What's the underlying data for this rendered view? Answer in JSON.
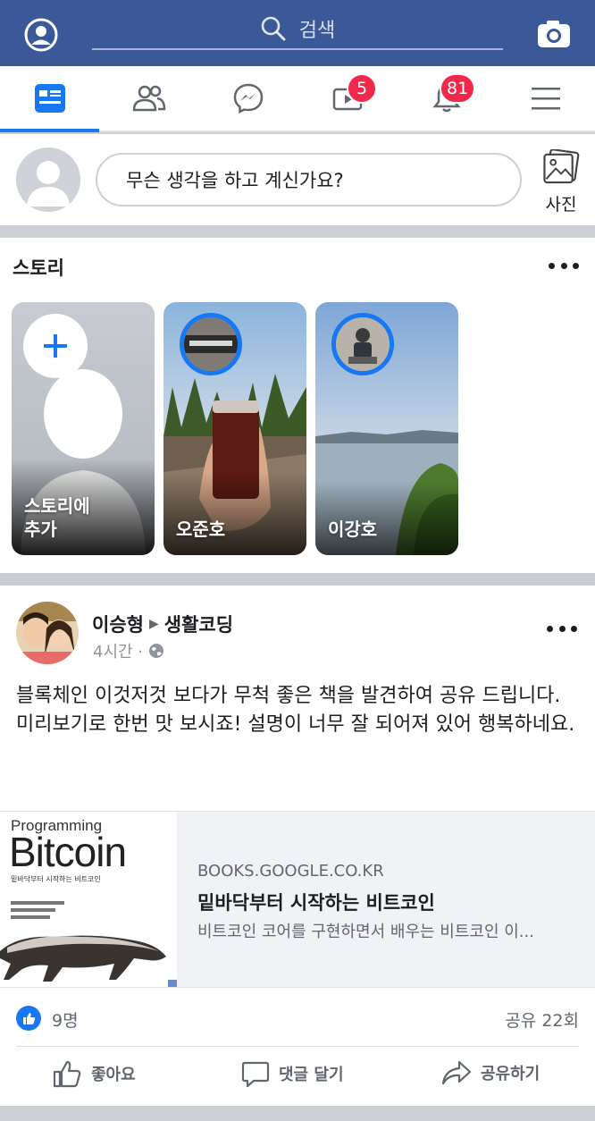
{
  "topbar": {
    "search_placeholder": "검색"
  },
  "nav": {
    "tabs": [
      "news-feed",
      "friends",
      "messenger",
      "watch",
      "notifications",
      "menu"
    ],
    "watch_badge": "5",
    "notifications_badge": "81",
    "accent": "#1877f2"
  },
  "composer": {
    "prompt": "무슨 생각을 하고 계신가요?",
    "photo_label": "사진"
  },
  "stories": {
    "title": "스토리",
    "items": [
      {
        "name": "스토리에\n추가",
        "kind": "add"
      },
      {
        "name": "오준호",
        "kind": "story"
      },
      {
        "name": "이강호",
        "kind": "story"
      }
    ]
  },
  "post": {
    "author": "이승형",
    "group": "생활코딩",
    "time": "4시간 ·",
    "body": "블록체인 이것저것 보다가 무척 좋은 책을 발견하여 공유 드립니다.\n미리보기로 한번 맛 보시죠! 설명이 너무 잘 되어져 있어 행복하네요.",
    "link": {
      "book_series": "Programming",
      "book_title": "Bitcoin",
      "book_subtitle": "밑바닥부터 시작하는 비트코인",
      "domain": "BOOKS.GOOGLE.CO.KR",
      "title": "밑바닥부터 시작하는 비트코인",
      "description": "비트코인 코어를 구현하면서 배우는 비트코인 이..."
    },
    "likes": "9명",
    "shares": "공유 22회",
    "actions": {
      "like": "좋아요",
      "comment": "댓글 달기",
      "share": "공유하기"
    }
  }
}
